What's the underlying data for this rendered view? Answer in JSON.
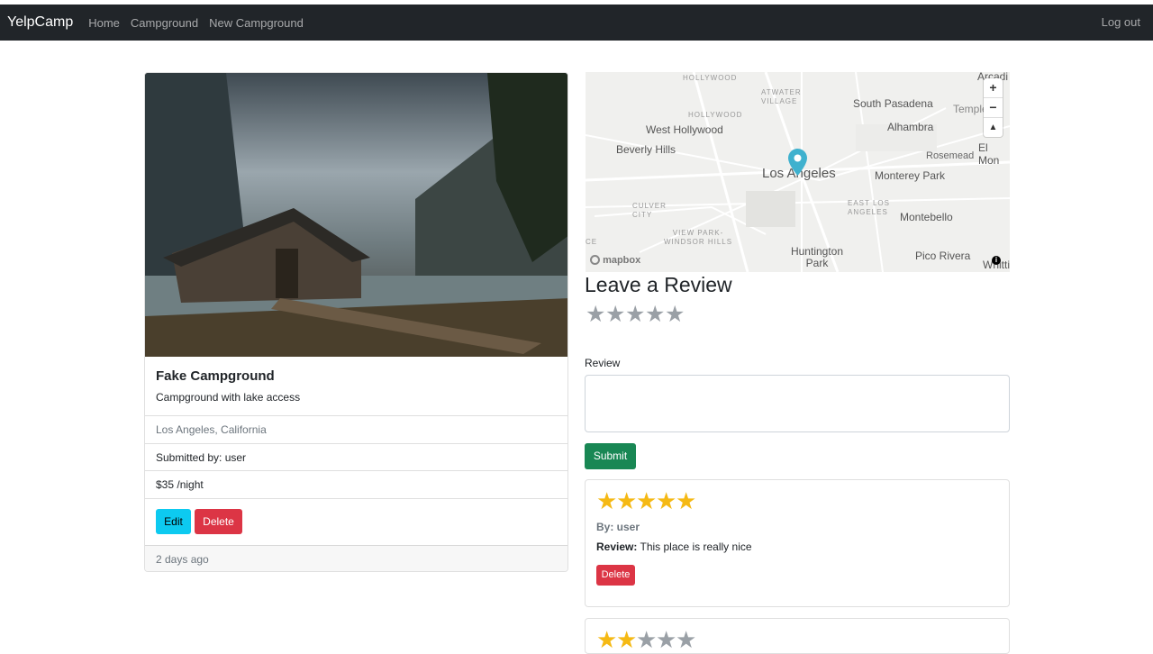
{
  "navbar": {
    "brand": "YelpCamp",
    "links": [
      "Home",
      "Campground",
      "New Campground"
    ],
    "logout": "Log out"
  },
  "campground": {
    "title": "Fake Campground",
    "description": "Campground with lake access",
    "location": "Los Angeles, California",
    "submitted_by": "Submitted by: user",
    "price": "$35 /night",
    "edit_label": "Edit",
    "delete_label": "Delete",
    "timestamp": "2 days ago"
  },
  "map": {
    "labels": {
      "hollywood": "HOLLYWOOD",
      "atwater": "ATWATER VILLAGE",
      "south_pasadena": "South Pasadena",
      "temple": "Temple",
      "arcadia": "Arcadi",
      "hollywood2": "HOLLYWOOD",
      "alhambra": "Alhambra",
      "west_hollywood": "West Hollywood",
      "el_monte": "El Mon",
      "rosemead": "Rosemead",
      "beverly_hills": "Beverly Hills",
      "los_angeles": "Los Angeles",
      "monterey_park": "Monterey Park",
      "culver": "CULVER CITY",
      "east_la": "EAST LOS ANGELES",
      "montebello": "Montebello",
      "view_park": "VIEW PARK-WINDSOR HILLS",
      "ce": "CE",
      "huntington_park": "Huntington Park",
      "pico_rivera": "Pico Rivera",
      "whittier": "Whitti"
    },
    "zoom_in": "+",
    "zoom_out": "−",
    "compass": "▲",
    "logo": "mapbox",
    "info": "i"
  },
  "review_form": {
    "heading": "Leave a Review",
    "label": "Review",
    "submit": "Submit"
  },
  "reviews": [
    {
      "stars": 5,
      "author": "By: user",
      "label": "Review:",
      "text": "This place is really nice",
      "delete": "Delete"
    },
    {
      "stars": 2
    }
  ]
}
